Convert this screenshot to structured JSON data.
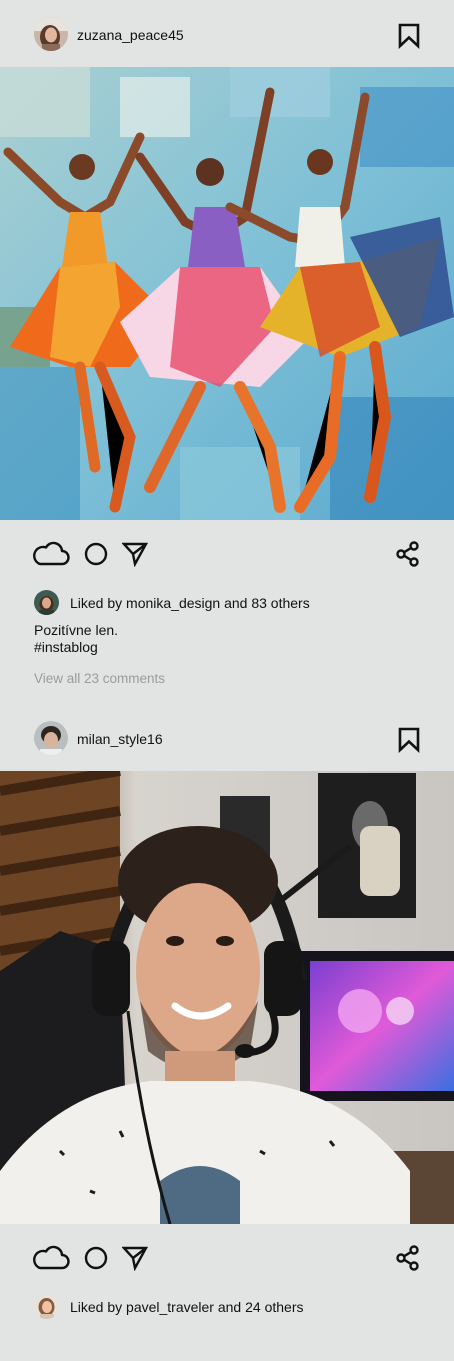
{
  "posts": [
    {
      "username": "zuzana_peace45",
      "likes_user": "monika_design",
      "likes_text": "Liked by monika_design and 83 others",
      "caption_line1": "Pozitívne len.",
      "caption_line2": "#instablog",
      "view_comments": "View all 23 comments",
      "image_description_icon": "ballet-dancers-painting"
    },
    {
      "username": "milan_style16",
      "likes_user": "pavel_traveler",
      "likes_text": "Liked by pavel_traveler and 24 others",
      "image_description_icon": "streamer-with-headset-photo"
    }
  ],
  "icons": {
    "like": "cloud-icon",
    "comment": "circle-icon",
    "send": "send-icon",
    "share": "share-icon",
    "bookmark": "bookmark-icon"
  },
  "colors": {
    "background": "#e2e4e3",
    "text": "#111111",
    "muted": "#9a9c9b"
  }
}
